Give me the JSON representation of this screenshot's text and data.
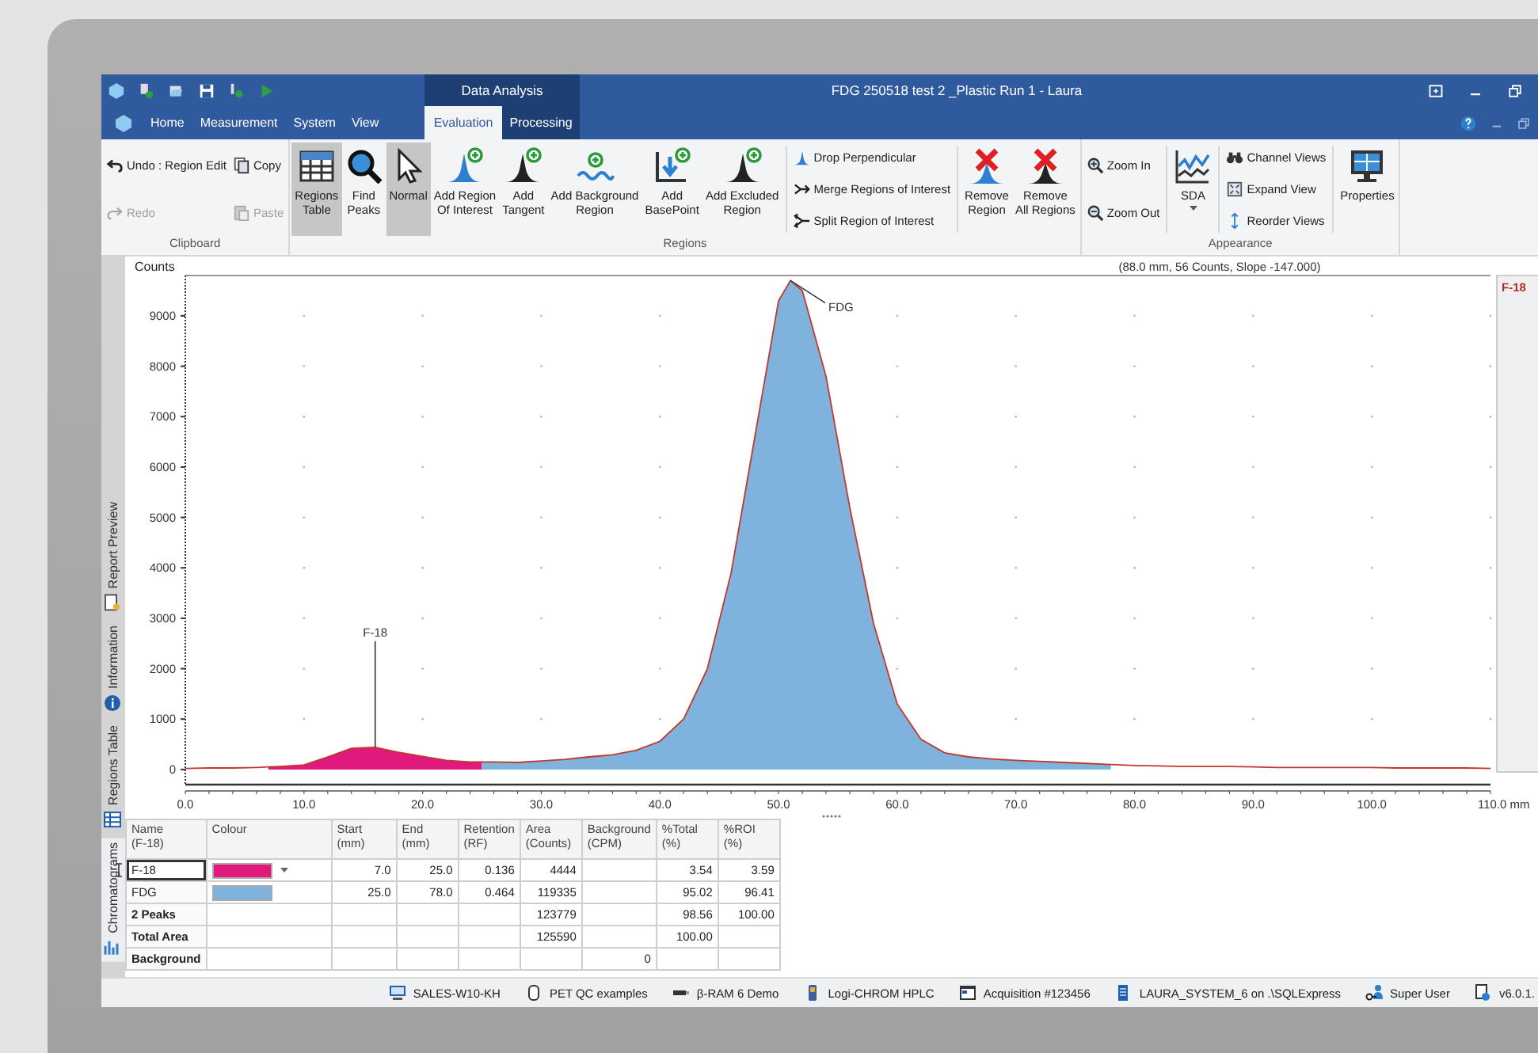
{
  "window": {
    "title": "FDG 250518 test 2 _Plastic Run 1 - Laura",
    "context_label": "Data Analysis"
  },
  "tabs": [
    {
      "label": "Home",
      "selected": false
    },
    {
      "label": "Measurement",
      "selected": false
    },
    {
      "label": "System",
      "selected": false
    },
    {
      "label": "View",
      "selected": false
    },
    {
      "label": "Evaluation",
      "selected": true
    },
    {
      "label": "Processing",
      "selected": false
    }
  ],
  "ribbon": {
    "groups": [
      {
        "label": "Clipboard",
        "items": [
          {
            "kind": "stack",
            "items": [
              {
                "label": "Undo : Region Edit",
                "disabled": false
              },
              {
                "label": "Redo",
                "disabled": true
              }
            ]
          },
          {
            "kind": "stack",
            "items": [
              {
                "label": "Copy",
                "disabled": false
              },
              {
                "label": "Paste",
                "disabled": true
              }
            ]
          }
        ]
      },
      {
        "label": "Regions",
        "items": [
          {
            "kind": "large",
            "label": "Regions\nTable",
            "selected": true
          },
          {
            "kind": "large",
            "label": "Find\nPeaks",
            "selected": false
          },
          {
            "kind": "large",
            "label": "Normal",
            "selected": true
          },
          {
            "kind": "large",
            "label": "Add Region\nOf Interest",
            "selected": false
          },
          {
            "kind": "large",
            "label": "Add\nTangent",
            "selected": false
          },
          {
            "kind": "large",
            "label": "Add Background\nRegion",
            "selected": false
          },
          {
            "kind": "large",
            "label": "Add\nBasePoint",
            "selected": false
          },
          {
            "kind": "large",
            "label": "Add Excluded\nRegion",
            "selected": false
          },
          {
            "kind": "stack",
            "items": [
              {
                "label": "Drop Perpendicular",
                "disabled": false
              },
              {
                "label": "Merge Regions of Interest",
                "disabled": false
              },
              {
                "label": "Split Region of Interest",
                "disabled": false
              }
            ]
          },
          {
            "kind": "large",
            "label": "Remove\nRegion",
            "selected": false
          },
          {
            "kind": "large",
            "label": "Remove\nAll Regions",
            "selected": false
          }
        ]
      },
      {
        "label": "Appearance",
        "items": [
          {
            "kind": "stack",
            "items": [
              {
                "label": "Zoom In",
                "disabled": false
              },
              {
                "label": "Zoom Out",
                "disabled": false
              }
            ]
          },
          {
            "kind": "dropdown",
            "label": "SDA",
            "selected": false
          },
          {
            "kind": "stack",
            "items": [
              {
                "label": "Channel Views",
                "disabled": false
              },
              {
                "label": "Expand View",
                "disabled": false
              },
              {
                "label": "Reorder Views",
                "disabled": false
              }
            ]
          },
          {
            "kind": "large",
            "label": "Properties",
            "selected": false
          }
        ]
      }
    ]
  },
  "side_tabs": [
    {
      "label": "Chromatograms",
      "selected": true
    },
    {
      "label": "Regions Table",
      "selected": false
    },
    {
      "label": "Information",
      "selected": false
    },
    {
      "label": "Report Preview",
      "selected": false
    }
  ],
  "chart": {
    "cursor_readout": "(88.0 mm, 56 Counts, Slope -147.000)",
    "side_label": "F-18",
    "chart_data": {
      "type": "area",
      "ylabel": "Counts",
      "x": [
        0,
        2,
        4,
        6,
        7,
        8,
        10,
        12,
        14,
        16,
        18,
        20,
        22,
        24,
        25,
        26,
        28,
        30,
        32,
        34,
        36,
        38,
        40,
        42,
        44,
        46,
        48,
        50,
        51,
        52,
        54,
        56,
        58,
        60,
        62,
        64,
        66,
        68,
        70,
        72,
        74,
        76,
        78,
        80,
        82,
        84,
        86,
        88,
        90,
        92,
        94,
        96,
        98,
        100,
        102,
        104,
        106,
        108,
        110
      ],
      "series": [
        {
          "name": "F-18",
          "color": "#e0197d",
          "values": [
            null,
            null,
            null,
            null,
            50,
            60,
            90,
            250,
            420,
            440,
            340,
            260,
            180,
            150,
            150,
            null,
            null,
            null,
            null,
            null,
            null,
            null,
            null,
            null,
            null,
            null,
            null,
            null,
            null,
            null,
            null,
            null,
            null,
            null,
            null,
            null,
            null,
            null,
            null,
            null,
            null,
            null,
            null,
            null,
            null,
            null,
            null,
            null,
            null,
            null,
            null,
            null,
            null,
            null,
            null,
            null,
            null,
            null,
            null
          ]
        },
        {
          "name": "FDG",
          "color": "#7fb2dc",
          "values": [
            null,
            null,
            null,
            null,
            null,
            null,
            null,
            null,
            null,
            null,
            null,
            null,
            null,
            null,
            150,
            150,
            140,
            170,
            200,
            250,
            290,
            380,
            560,
            1000,
            2000,
            3900,
            6600,
            9300,
            9700,
            9500,
            7800,
            5200,
            2900,
            1300,
            600,
            330,
            250,
            210,
            180,
            160,
            140,
            120,
            100,
            null,
            null,
            null,
            null,
            null,
            null,
            null,
            null,
            null,
            null,
            null,
            null,
            null,
            null,
            null,
            null
          ]
        },
        {
          "color": "#c0392b",
          "type": "line",
          "values": [
            20,
            30,
            30,
            40,
            50,
            60,
            90,
            250,
            420,
            440,
            340,
            260,
            180,
            150,
            150,
            150,
            140,
            170,
            200,
            250,
            290,
            380,
            560,
            1000,
            2000,
            3900,
            6600,
            9300,
            9700,
            9500,
            7800,
            5200,
            2900,
            1300,
            600,
            330,
            250,
            210,
            180,
            160,
            140,
            120,
            100,
            80,
            70,
            60,
            60,
            60,
            50,
            40,
            40,
            40,
            40,
            40,
            30,
            30,
            30,
            30,
            20
          ]
        }
      ],
      "xlim": [
        0,
        110
      ],
      "ylim": [
        -300,
        9800
      ],
      "xticks": [
        {
          "value": 0,
          "label": "0.0"
        },
        {
          "value": 10,
          "label": "10.0"
        },
        {
          "value": 20,
          "label": "20.0"
        },
        {
          "value": 30,
          "label": "30.0"
        },
        {
          "value": 40,
          "label": "40.0"
        },
        {
          "value": 50,
          "label": "50.0"
        },
        {
          "value": 60,
          "label": "60.0"
        },
        {
          "value": 70,
          "label": "70.0"
        },
        {
          "value": 80,
          "label": "80.0"
        },
        {
          "value": 90,
          "label": "90.0"
        },
        {
          "value": 100,
          "label": "100.0"
        },
        {
          "value": 110,
          "label": "110.0 mm"
        }
      ],
      "yticks": [
        0,
        1000,
        2000,
        3000,
        4000,
        5000,
        6000,
        7000,
        8000,
        9000
      ]
    }
  },
  "table": {
    "columns": [
      "Name\n(F-18)",
      "Colour",
      "Start\n(mm)",
      "End\n(mm)",
      "Retention\n(RF)",
      "Area\n(Counts)",
      "Background\n(CPM)",
      "%Total\n(%)",
      "%ROI\n(%)"
    ],
    "rows": [
      {
        "kind": "region",
        "selected": true,
        "color": "#e0197d",
        "cells": [
          "F-18",
          "",
          "7.0",
          "25.0",
          "0.136",
          "4444",
          "",
          "3.54",
          "3.59"
        ]
      },
      {
        "kind": "region",
        "selected": false,
        "color": "#7fb2dc",
        "cells": [
          "FDG",
          "",
          "25.0",
          "78.0",
          "0.464",
          "119335",
          "",
          "95.02",
          "96.41"
        ]
      },
      {
        "kind": "summary",
        "selected": false,
        "cells": [
          "2 Peaks",
          "",
          "",
          "",
          "",
          "123779",
          "",
          "98.56",
          "100.00"
        ]
      },
      {
        "kind": "summary",
        "selected": false,
        "cells": [
          "Total Area",
          "",
          "",
          "",
          "",
          "125590",
          "",
          "100.00",
          ""
        ]
      },
      {
        "kind": "summary",
        "selected": false,
        "cells": [
          "Background",
          "",
          "",
          "",
          "",
          "",
          "0",
          "",
          ""
        ]
      }
    ]
  },
  "status_bar": [
    "SALES-W10-KH",
    "PET QC examples",
    "β-RAM 6 Demo",
    "Logi-CHROM HPLC",
    "Acquisition #123456",
    "LAURA_SYSTEM_6 on .\\SQLExpress",
    "Super User",
    "v6.0.1."
  ]
}
